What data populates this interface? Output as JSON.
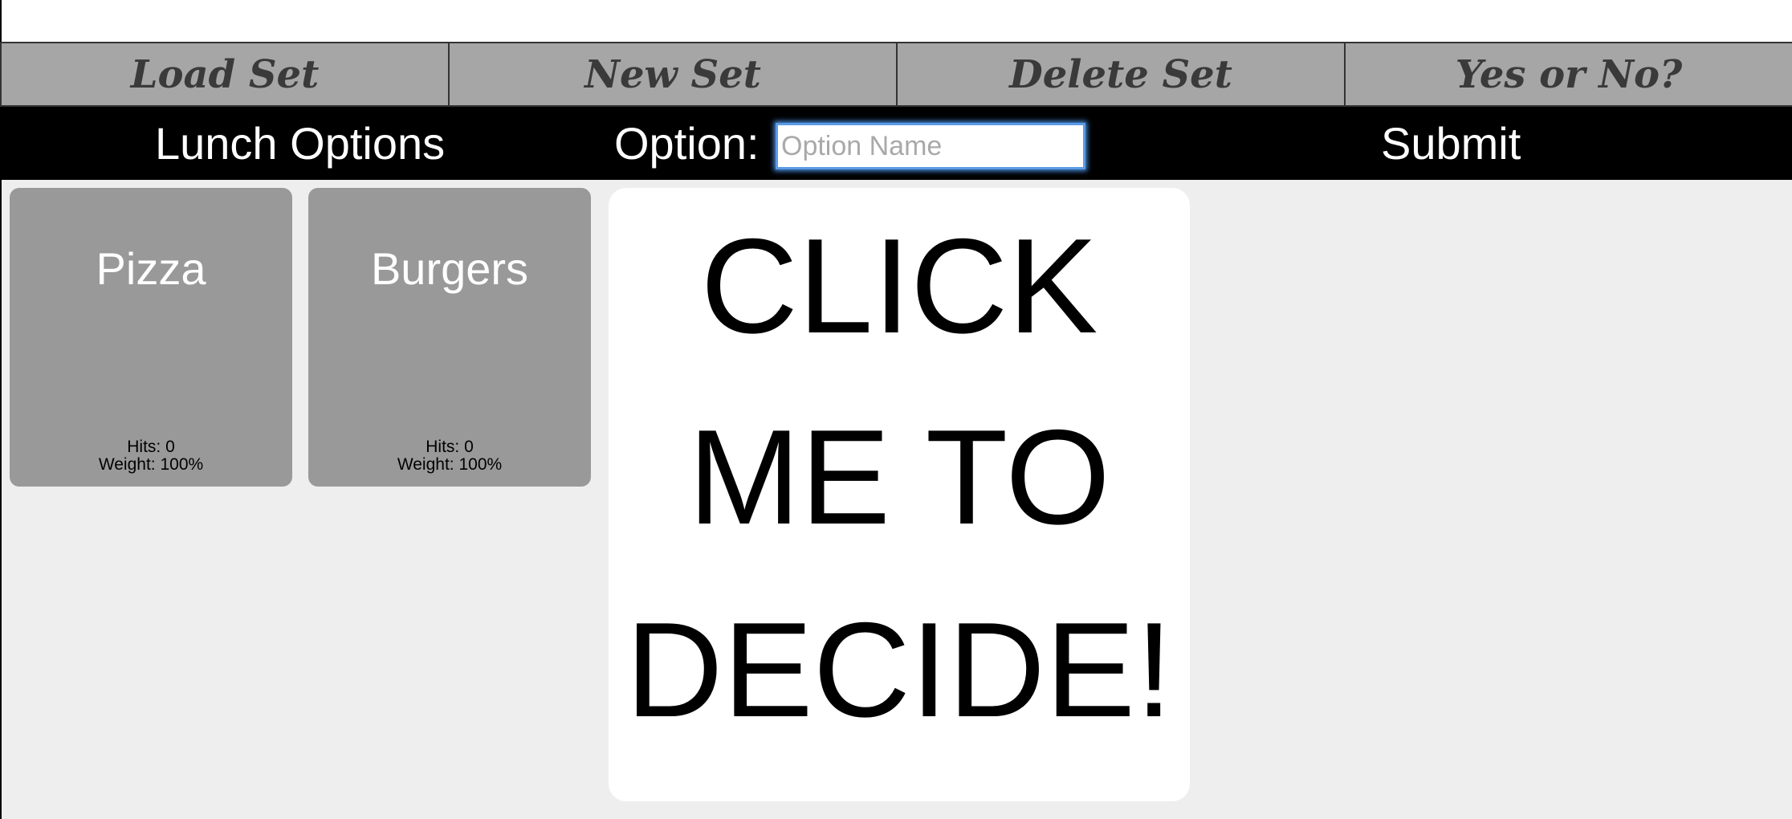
{
  "menu": {
    "load_label": "Load Set",
    "new_label": "New Set",
    "delete_label": "Delete Set",
    "yesno_label": "Yes or No?"
  },
  "setbar": {
    "set_name": "Lunch Options",
    "option_label": "Option:",
    "option_value": "",
    "option_placeholder": "Option Name",
    "submit_label": "Submit"
  },
  "options": [
    {
      "name": "Pizza",
      "hits_text": "Hits: 0",
      "weight_text": "Weight: 100%"
    },
    {
      "name": "Burgers",
      "hits_text": "Hits: 0",
      "weight_text": "Weight: 100%"
    }
  ],
  "decide": {
    "line1": "CLICK",
    "line2": "ME TO",
    "line3": "DECIDE!"
  },
  "colors": {
    "menubar": "#a6a6a6",
    "setbar": "#000000",
    "card": "#999999",
    "input_focus": "#4a8fdf",
    "background": "#eeeeee"
  }
}
